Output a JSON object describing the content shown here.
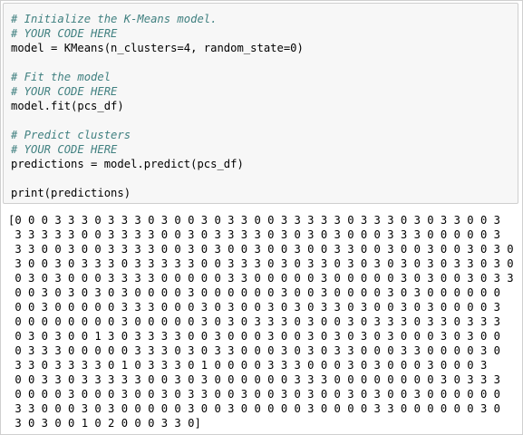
{
  "code_lines": [
    "# Initialize the K-Means model.",
    "# YOUR CODE HERE",
    "model = KMeans(n_clusters=4, random_state=0)",
    "",
    "# Fit the model",
    "# YOUR CODE HERE",
    "model.fit(pcs_df)",
    "",
    "# Predict clusters",
    "# YOUR CODE HERE",
    "predictions = model.predict(pcs_df)",
    "",
    "print(predictions)"
  ],
  "output_lines": [
    "[0 0 0 3 3 3 0 3 3 3 0 3 0 0 3 0 3 3 0 0 3 3 3 3 3 0 3 3 3 0 3 0 3 3 0 0 3",
    " 3 3 3 3 3 0 0 3 3 3 3 0 0 3 0 3 3 3 3 0 3 0 3 0 3 0 0 0 3 3 3 0 0 0 0 0 3",
    " 3 3 0 0 3 0 0 3 3 3 3 0 0 3 0 3 0 0 3 0 0 3 0 0 3 3 0 0 3 0 0 3 0 0 3 0 3 0",
    " 3 0 0 3 0 3 3 3 0 3 3 3 3 3 0 0 3 3 3 0 3 0 3 3 0 3 0 3 0 3 0 3 0 3 3 0 3 0",
    " 0 3 0 3 0 0 0 3 3 3 3 0 0 0 0 0 3 3 0 0 0 0 0 3 0 0 0 0 0 3 0 3 0 0 3 0 3 3",
    " 0 0 3 0 3 0 3 0 3 0 0 0 0 3 0 0 0 0 0 0 3 0 0 3 0 0 0 0 3 0 3 0 0 0 0 0 0",
    " 0 0 3 0 0 0 0 0 3 3 3 0 0 0 3 0 3 0 0 3 0 3 0 3 3 0 3 0 0 3 0 3 0 0 0 0 3",
    " 0 0 0 0 0 0 0 0 3 0 0 0 0 0 3 0 3 0 3 3 3 0 3 0 0 3 0 3 3 3 0 3 3 0 3 3 3",
    " 0 3 0 3 0 0 1 3 0 3 3 3 3 0 0 3 0 0 0 3 0 0 3 0 3 0 3 0 3 0 0 0 3 0 3 0 0",
    " 0 3 3 3 0 0 0 0 0 3 3 3 0 3 0 3 3 0 0 0 3 0 3 0 3 3 0 0 0 3 3 0 0 0 0 3 0",
    " 3 3 0 3 3 3 3 0 1 0 3 3 3 0 1 0 0 0 0 3 3 3 0 0 0 3 0 3 0 0 0 3 0 0 0 3",
    " 0 0 3 3 0 3 3 3 3 3 0 0 3 0 3 0 0 0 0 0 0 3 3 3 0 0 0 0 0 0 0 0 3 0 3 3 3",
    " 0 0 0 0 3 0 0 0 3 0 0 3 0 3 3 0 0 3 0 0 3 0 3 0 0 3 0 3 0 0 3 0 0 0 0 0 0",
    " 3 3 0 0 0 3 0 3 0 0 0 0 0 3 0 0 3 0 0 0 0 0 3 0 0 0 0 3 3 0 0 0 0 0 0 3 0",
    " 3 0 3 0 0 1 0 2 0 0 0 3 3 0]"
  ]
}
